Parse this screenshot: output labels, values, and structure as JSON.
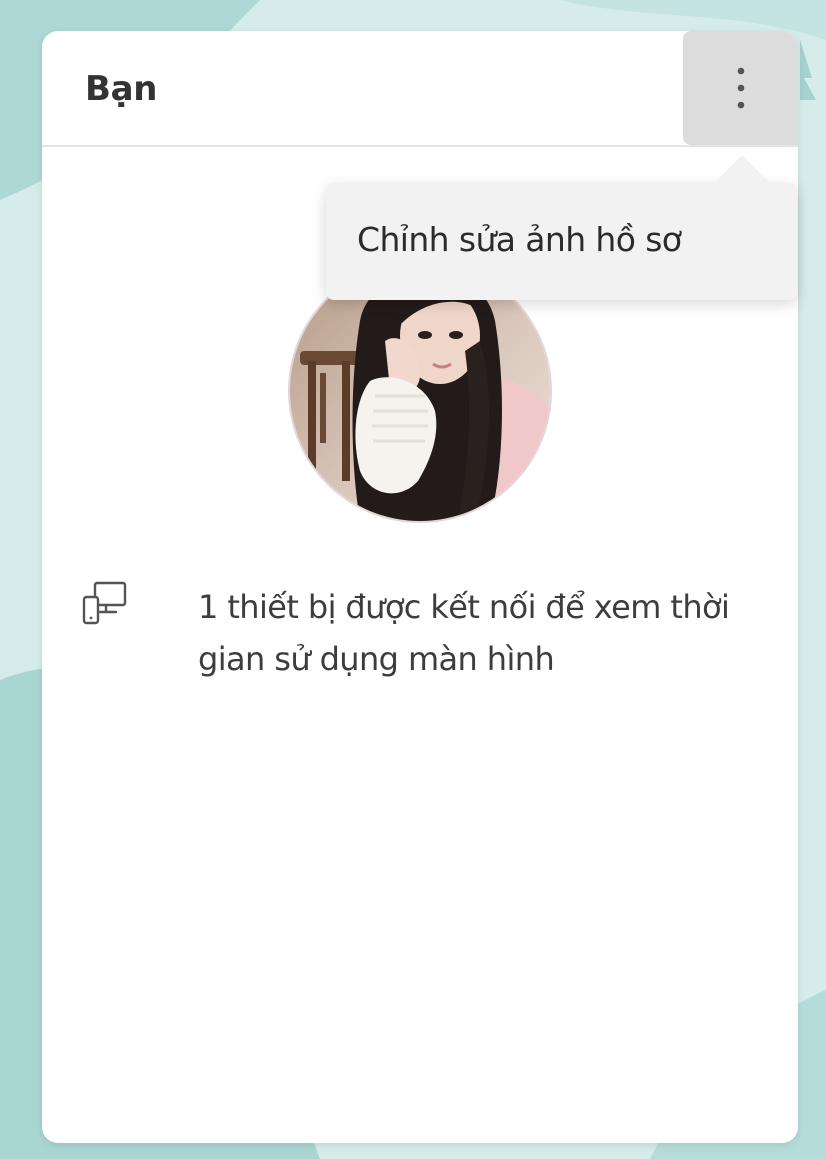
{
  "card": {
    "title": "Bạn"
  },
  "header": {
    "more_icon": "more-vertical-icon"
  },
  "profile": {
    "avatar_icon": "profile-photo"
  },
  "devices": {
    "icon": "devices-icon",
    "text": "1 thiết bị được kết nối để xem thời gian sử dụng màn hình"
  },
  "menu": {
    "items": [
      {
        "label": "Chỉnh sửa ảnh hồ sơ"
      }
    ]
  },
  "colors": {
    "background": "#cfe8e7",
    "card": "#ffffff",
    "more_button": "#dcdcdc",
    "menu": "#f2f2f2",
    "text": "#333333"
  }
}
